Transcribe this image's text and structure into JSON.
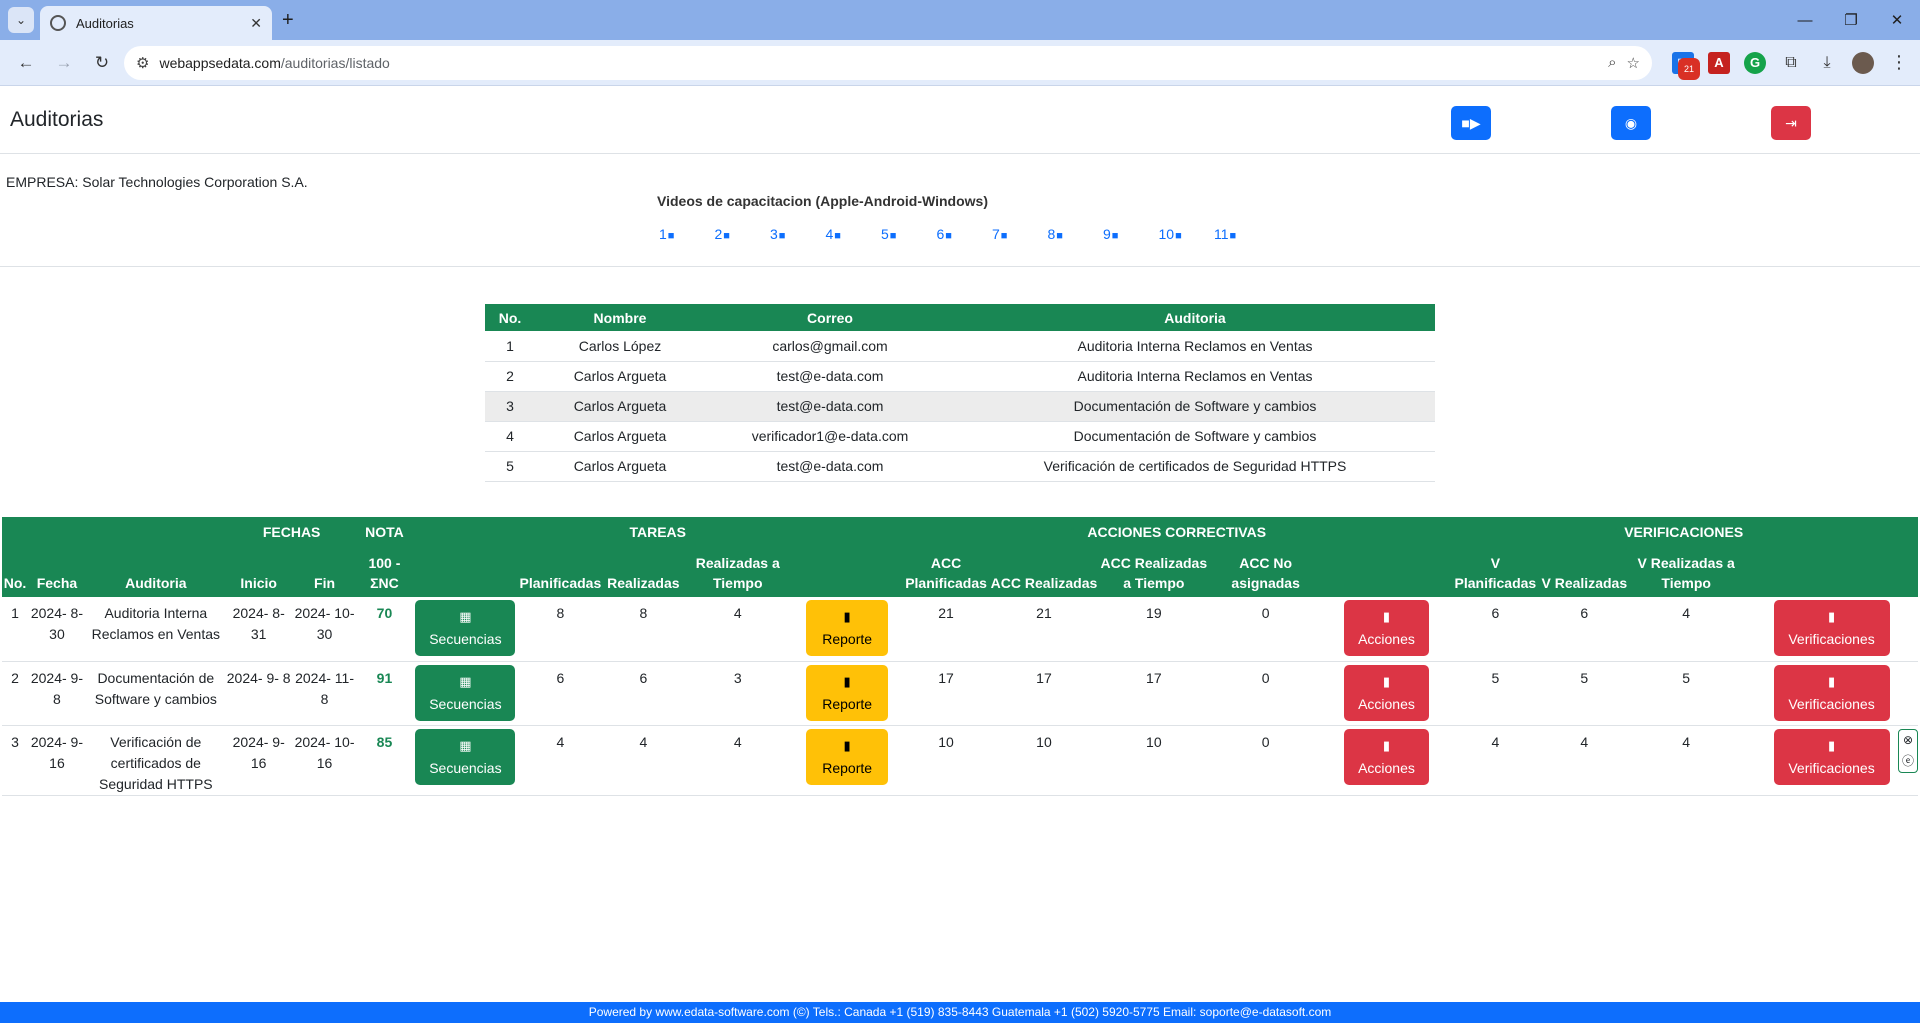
{
  "browser": {
    "tab_title": "Auditorias",
    "url_host": "webappsedata.com",
    "url_path": "/auditorias/listado",
    "calendar_badge": "21"
  },
  "header": {
    "title": "Auditorias"
  },
  "company_line": "EMPRESA: Solar Technologies Corporation S.A.",
  "videos": {
    "title": "Videos de capacitacion (Apple-Android-Windows)",
    "links": [
      "1",
      "2",
      "3",
      "4",
      "5",
      "6",
      "7",
      "8",
      "9",
      "10",
      "11"
    ]
  },
  "auditors": {
    "headers": [
      "No.",
      "Nombre",
      "Correo",
      "Auditoria"
    ],
    "rows": [
      [
        "1",
        "Carlos López",
        "carlos@gmail.com",
        "Auditoria Interna Reclamos en Ventas"
      ],
      [
        "2",
        "Carlos Argueta",
        "test@e-data.com",
        "Auditoria Interna Reclamos en Ventas"
      ],
      [
        "3",
        "Carlos Argueta",
        "test@e-data.com",
        "Documentación de Software y cambios"
      ],
      [
        "4",
        "Carlos Argueta",
        "verificador1@e-data.com",
        "Documentación de Software y cambios"
      ],
      [
        "5",
        "Carlos Argueta",
        "test@e-data.com",
        "Verificación de certificados de Seguridad HTTPS"
      ]
    ]
  },
  "main": {
    "groups": {
      "fechas": "FECHAS",
      "nota": "NOTA",
      "tareas": "TAREAS",
      "acciones": "ACCIONES CORRECTIVAS",
      "verificaciones": "VERIFICACIONES"
    },
    "headers": {
      "no": "No.",
      "fecha": "Fecha",
      "auditoria": "Auditoria",
      "inicio": "Inicio",
      "fin": "Fin",
      "nota": "100 - ΣNC",
      "planificadas": "Planificadas",
      "realizadas": "Realizadas",
      "realizadas_tiempo": "Realizadas a Tiempo",
      "acc_planificadas": "ACC Planificadas",
      "acc_realizadas": "ACC Realizadas",
      "acc_realizadas_tiempo": "ACC Realizadas a Tiempo",
      "acc_no_asignadas": "ACC No asignadas",
      "v_planificadas": "V Planificadas",
      "v_realizadas": "V Realizadas",
      "v_realizadas_tiempo": "V Realizadas a Tiempo"
    },
    "buttons": {
      "secuencias": "Secuencias",
      "reporte": "Reporte",
      "acciones": "Acciones",
      "verificaciones": "Verificaciones"
    },
    "rows": [
      {
        "no": "1",
        "fecha": "2024- 8- 30",
        "auditoria": "Auditoria Interna Reclamos en Ventas",
        "inicio": "2024- 8- 31",
        "fin": "2024- 10- 30",
        "nota": "70",
        "t_plan": "8",
        "t_real": "8",
        "t_tiempo": "4",
        "acc_plan": "21",
        "acc_real": "21",
        "acc_tiempo": "19",
        "acc_no": "0",
        "v_plan": "6",
        "v_real": "6",
        "v_tiempo": "4"
      },
      {
        "no": "2",
        "fecha": "2024- 9- 8",
        "auditoria": "Documentación de Software y cambios",
        "inicio": "2024- 9- 8",
        "fin": "2024- 11- 8",
        "nota": "91",
        "t_plan": "6",
        "t_real": "6",
        "t_tiempo": "3",
        "acc_plan": "17",
        "acc_real": "17",
        "acc_tiempo": "17",
        "acc_no": "0",
        "v_plan": "5",
        "v_real": "5",
        "v_tiempo": "5"
      },
      {
        "no": "3",
        "fecha": "2024- 9- 16",
        "auditoria": "Verificación de certificados de Seguridad HTTPS",
        "inicio": "2024- 9- 16",
        "fin": "2024- 10- 16",
        "nota": "85",
        "t_plan": "4",
        "t_real": "4",
        "t_tiempo": "4",
        "acc_plan": "10",
        "acc_real": "10",
        "acc_tiempo": "10",
        "acc_no": "0",
        "v_plan": "4",
        "v_real": "4",
        "v_tiempo": "4"
      }
    ]
  },
  "footer": "Powered by www.edata-software.com (©) Tels.: Canada +1 (519) 835-8443 Guatemala +1 (502) 5920-5775 Email: soporte@e-datasoft.com",
  "colors": {
    "green": "#198754",
    "blue": "#0d6efd",
    "red": "#dc3545",
    "yellow": "#ffc107"
  },
  "icons": {
    "video": "video-camera-icon",
    "support": "headset-icon",
    "logout": "sign-out-icon",
    "grid": "grid-icon",
    "file": "file-icon"
  }
}
